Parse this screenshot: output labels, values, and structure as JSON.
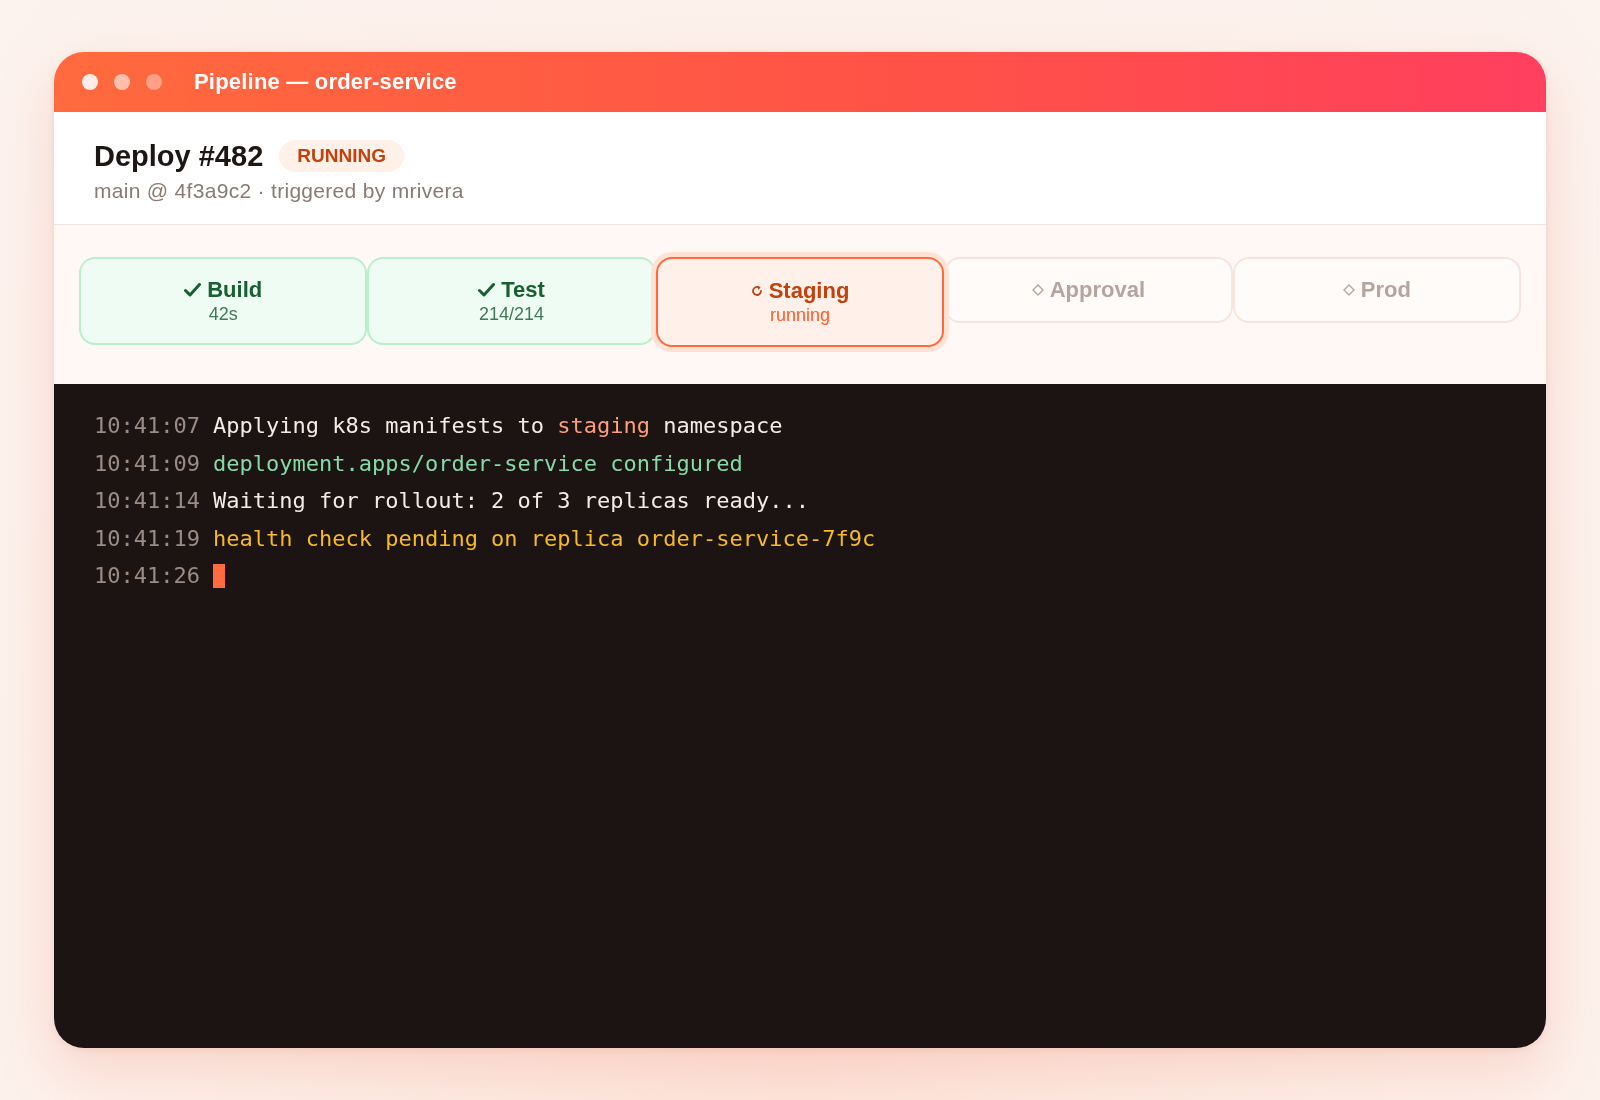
{
  "window": {
    "title": "Pipeline — order-service"
  },
  "deploy": {
    "title": "Deploy #482",
    "status": "RUNNING",
    "meta": "main @ 4f3a9c2 · triggered by mrivera"
  },
  "stages": [
    {
      "name": "Build",
      "detail": "42s",
      "kind": "done"
    },
    {
      "name": "Test",
      "detail": "214/214",
      "kind": "done"
    },
    {
      "name": "Staging",
      "detail": "running",
      "kind": "running"
    },
    {
      "name": "Approval",
      "kind": "pending"
    },
    {
      "name": "Prod",
      "kind": "pending"
    }
  ],
  "log": [
    {
      "time": "10:41:07",
      "cursor": false,
      "segments": [
        {
          "text": "Applying k8s manifests to ",
          "kind": "plain"
        },
        {
          "text": "staging",
          "kind": "accent"
        },
        {
          "text": " namespace",
          "kind": "plain"
        }
      ]
    },
    {
      "time": "10:41:09",
      "cursor": false,
      "segments": [
        {
          "text": "deployment.apps/order-service configured",
          "kind": "success"
        }
      ]
    },
    {
      "time": "10:41:14",
      "cursor": false,
      "segments": [
        {
          "text": "Waiting for rollout: 2 of 3 replicas ready...",
          "kind": "plain"
        }
      ]
    },
    {
      "time": "10:41:19",
      "cursor": false,
      "segments": [
        {
          "text": "health check pending on replica order-service-7f9c",
          "kind": "warning"
        }
      ]
    },
    {
      "time": "10:41:26",
      "cursor": true
    }
  ]
}
